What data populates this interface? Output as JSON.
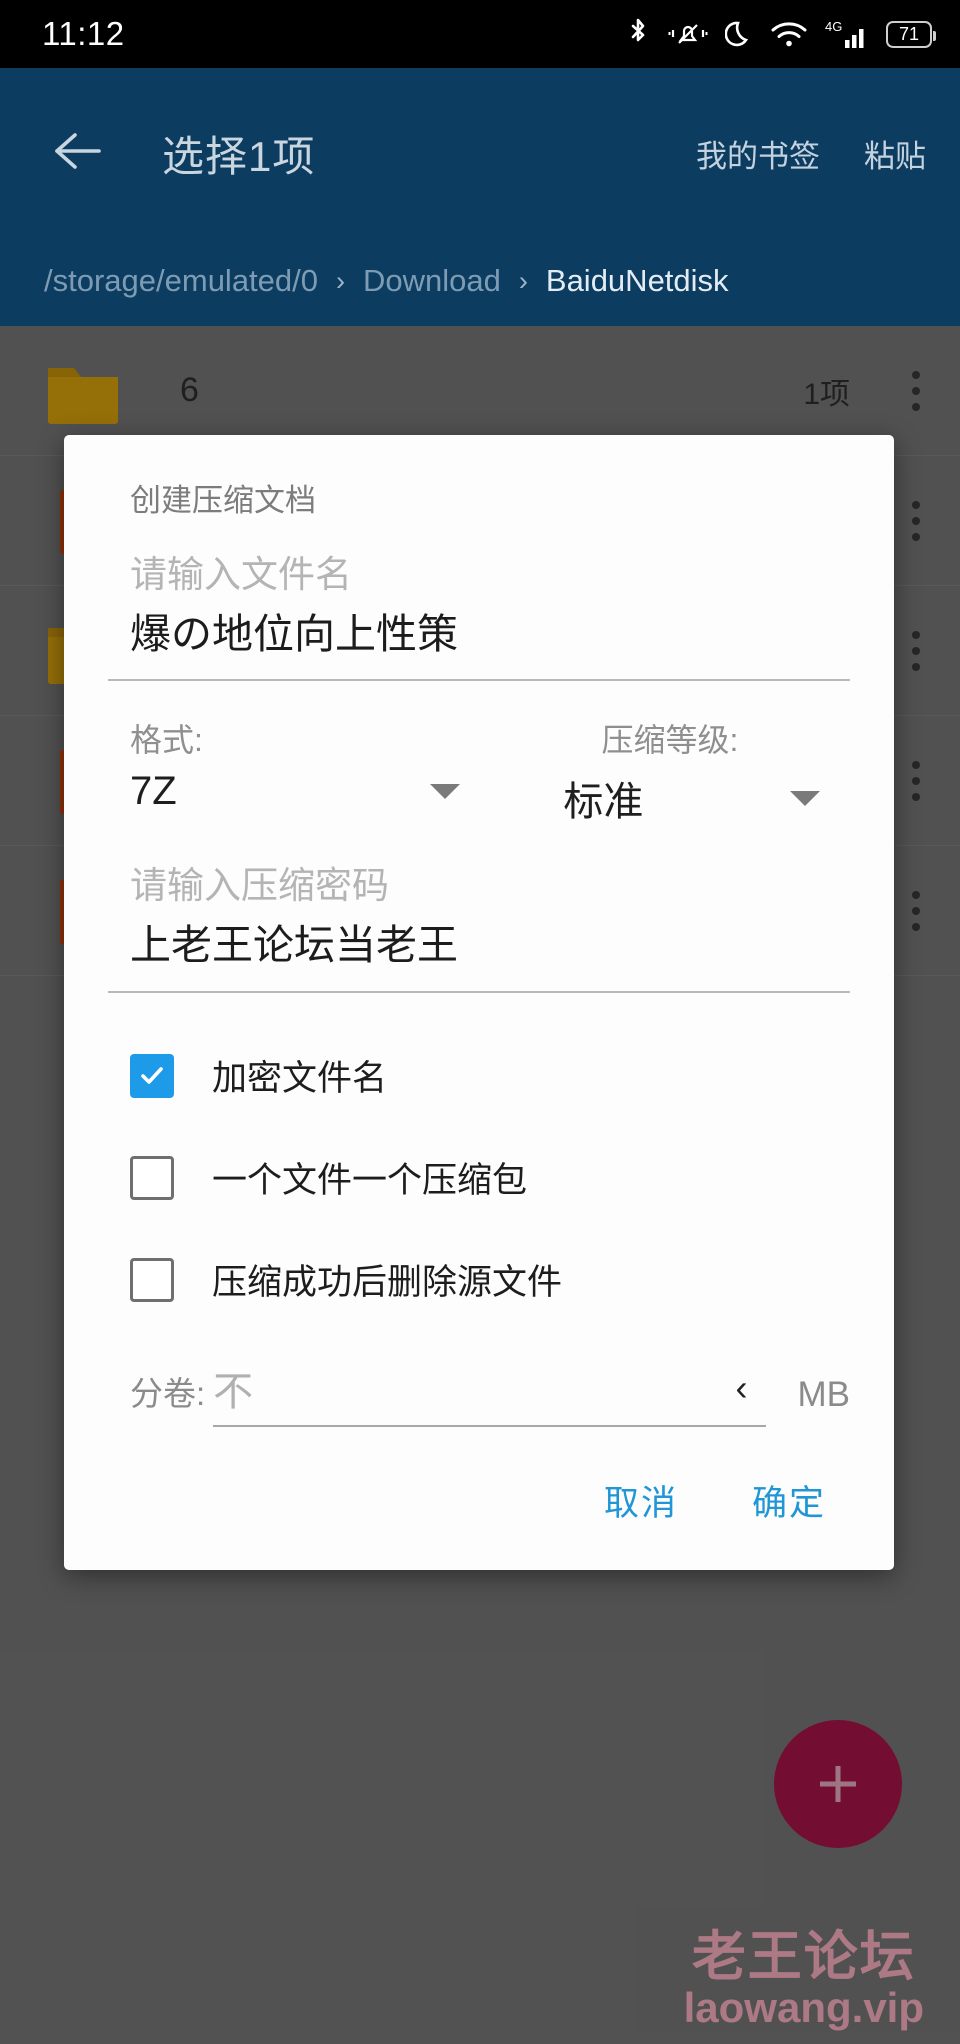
{
  "statusbar": {
    "time": "11:12",
    "battery_percent": "71",
    "icons": [
      "bluetooth-icon",
      "vibrate-mute-icon",
      "do-not-disturb-moon-icon",
      "wifi-icon",
      "signal-4g-icon",
      "battery-icon"
    ],
    "network_label": "4G"
  },
  "appbar": {
    "back_icon": "arrow-left-icon",
    "title": "选择1项",
    "actions": [
      {
        "label": "我的书签",
        "name": "my-bookmarks-action"
      },
      {
        "label": "粘贴",
        "name": "paste-action"
      }
    ],
    "color": "#0d3c61"
  },
  "breadcrumb": {
    "separator": "›",
    "items": [
      {
        "label": "/storage/emulated/0",
        "active": false
      },
      {
        "label": "Download",
        "active": false
      },
      {
        "label": "BaiduNetdisk",
        "active": true
      }
    ]
  },
  "filelist": {
    "rows": [
      {
        "icon": "folder-icon",
        "name": "6",
        "meta": "1项"
      },
      {
        "icon": "file-icon",
        "name": "",
        "meta": ""
      },
      {
        "icon": "folder-icon",
        "name": "",
        "meta": ""
      },
      {
        "icon": "file-icon",
        "name": "",
        "meta": ""
      },
      {
        "icon": "file-icon",
        "name": "",
        "meta": ""
      }
    ],
    "overflow_icon": "more-vertical-icon"
  },
  "fab": {
    "icon": "plus-icon",
    "color": "#9c1244"
  },
  "watermark": {
    "line1": "老王论坛",
    "line2": "laowang.vip",
    "color": "#e8a4b4"
  },
  "dialog": {
    "title": "创建压缩文档",
    "filename": {
      "placeholder": "请输入文件名",
      "value": "爆の地位向上性策"
    },
    "format": {
      "label": "格式:",
      "value": "7Z"
    },
    "level": {
      "label": "压缩等级:",
      "value": "标准"
    },
    "password": {
      "placeholder": "请输入压缩密码",
      "value": "上老王论坛当老王"
    },
    "checkboxes": [
      {
        "label": "加密文件名",
        "checked": true,
        "name": "encrypt-filename-checkbox"
      },
      {
        "label": "一个文件一个压缩包",
        "checked": false,
        "name": "one-file-per-archive-checkbox"
      },
      {
        "label": "压缩成功后删除源文件",
        "checked": false,
        "name": "delete-source-after-checkbox"
      }
    ],
    "volume": {
      "label": "分卷:",
      "value": "不",
      "chevron": "‹",
      "unit": "MB"
    },
    "buttons": {
      "cancel": "取消",
      "confirm": "确定",
      "accent": "#2196d6"
    }
  }
}
